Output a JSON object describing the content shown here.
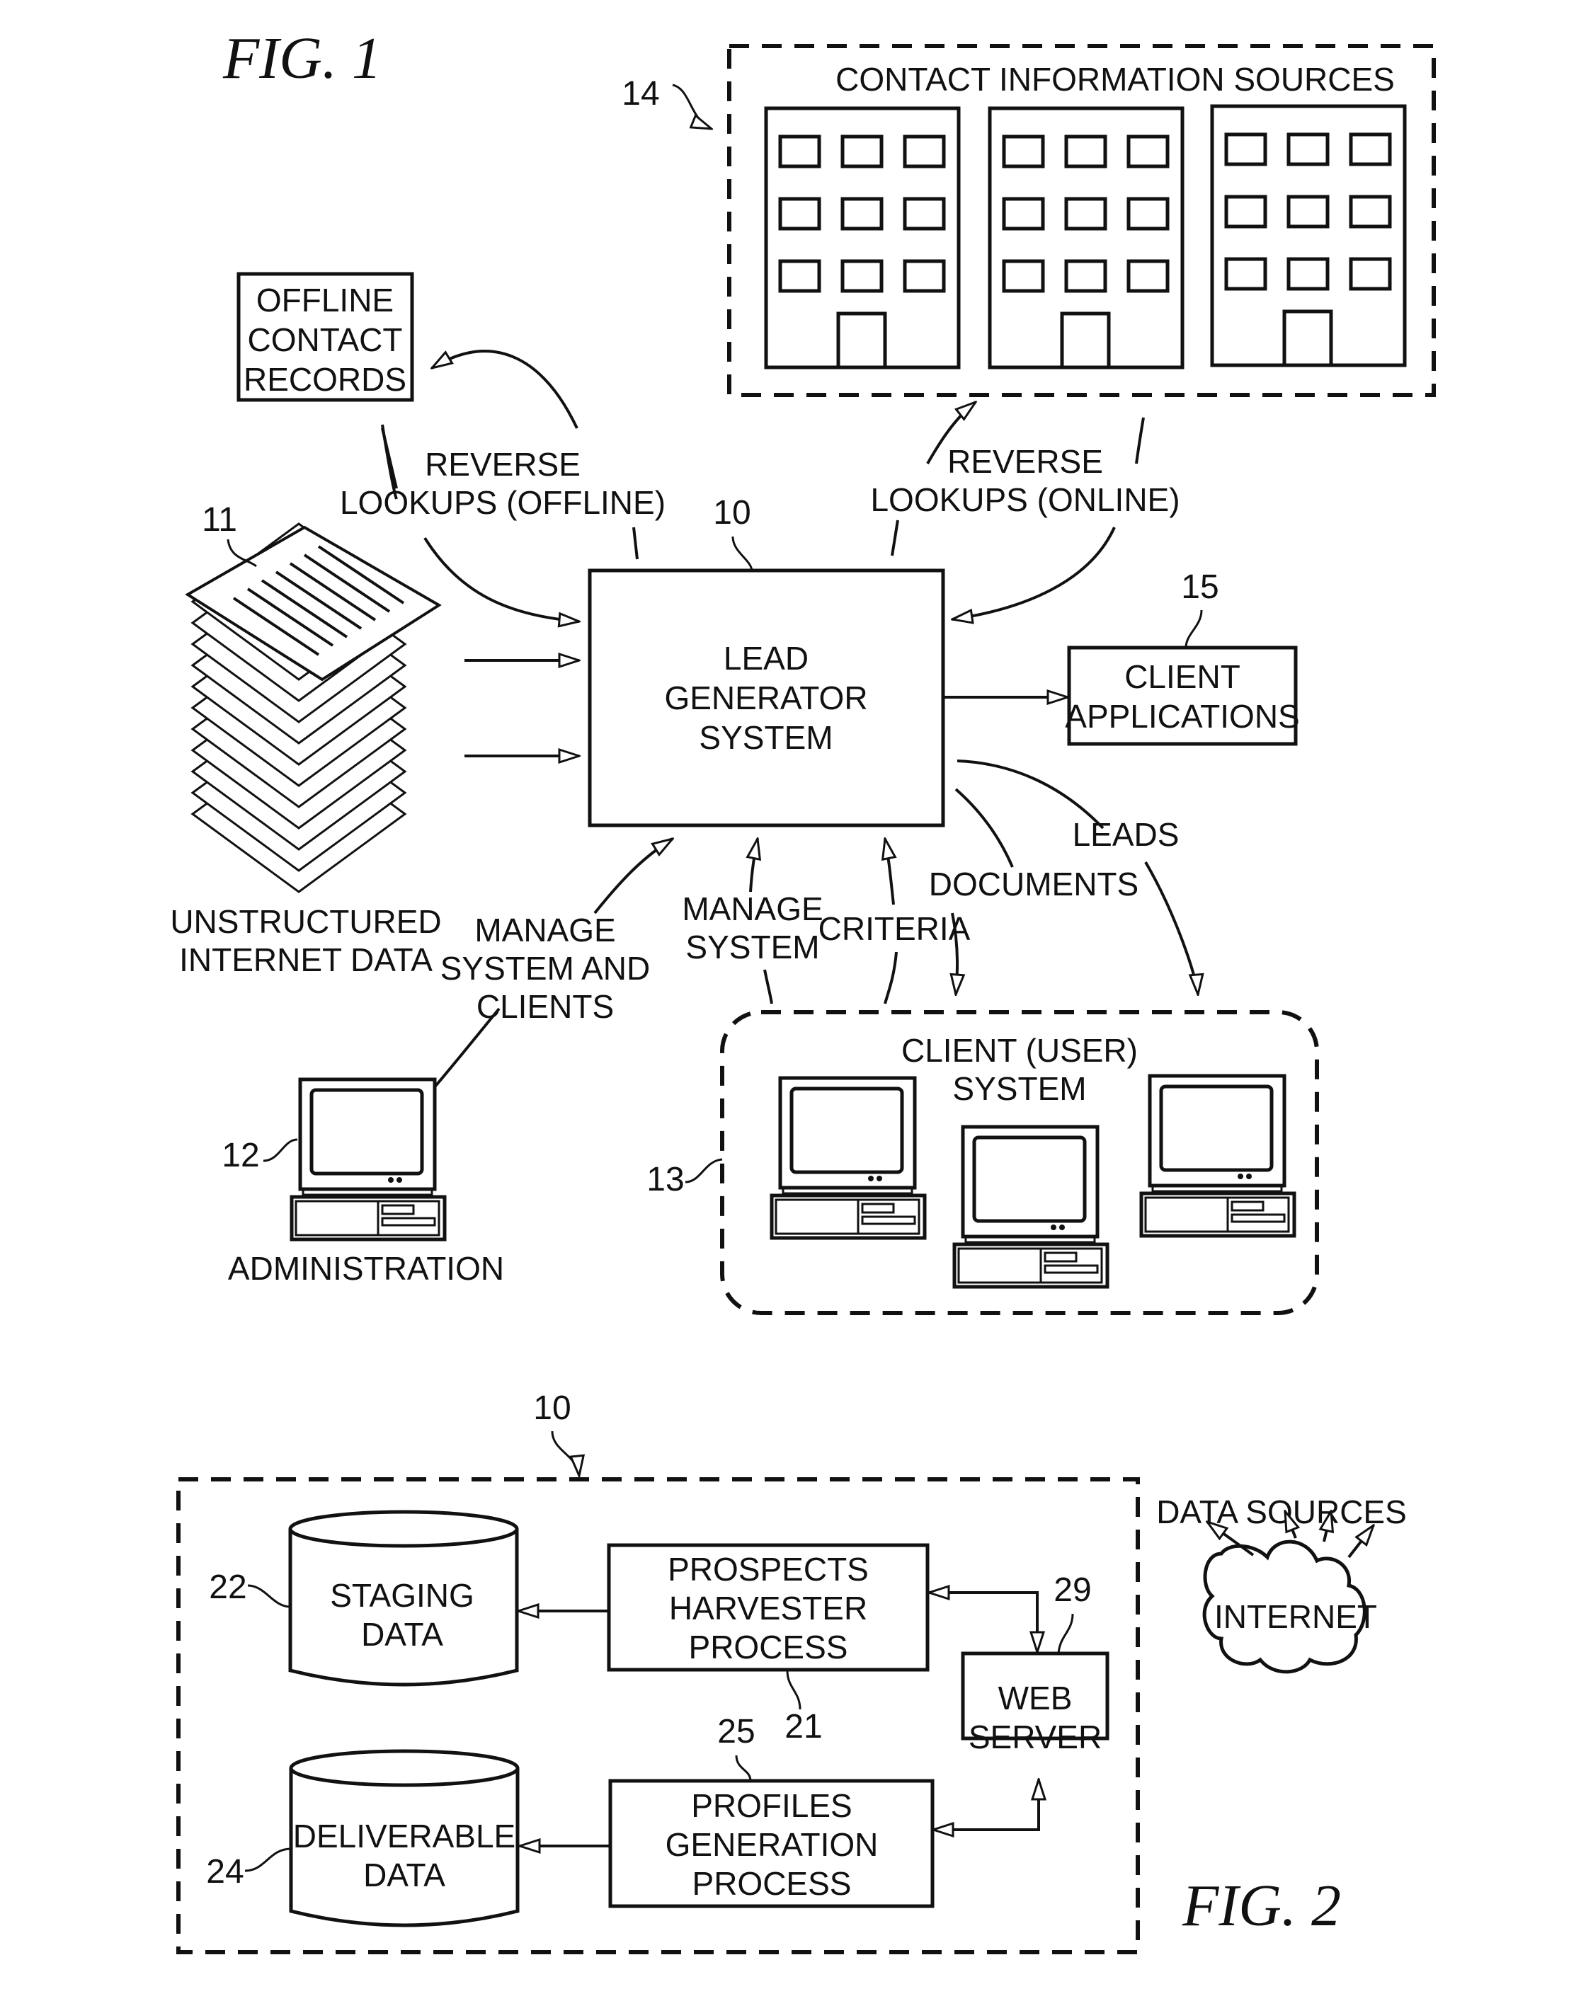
{
  "fig1": {
    "title": "FIG. 1",
    "contact_sources": {
      "ref": "14",
      "label": "CONTACT INFORMATION SOURCES"
    },
    "offline_records": {
      "lines": [
        "OFFLINE",
        "CONTACT",
        "RECORDS"
      ]
    },
    "reverse_offline": {
      "lines": [
        "REVERSE",
        "LOOKUPS (OFFLINE)"
      ]
    },
    "reverse_online": {
      "lines": [
        "REVERSE",
        "LOOKUPS (ONLINE)"
      ]
    },
    "unstructured": {
      "ref": "11",
      "lines": [
        "UNSTRUCTURED",
        "INTERNET DATA"
      ]
    },
    "lead_generator": {
      "ref": "10",
      "lines": [
        "LEAD",
        "GENERATOR",
        "SYSTEM"
      ]
    },
    "client_apps": {
      "ref": "15",
      "lines": [
        "CLIENT",
        "APPLICATIONS"
      ]
    },
    "manage_system_clients": {
      "lines": [
        "MANAGE",
        "SYSTEM AND",
        "CLIENTS"
      ]
    },
    "manage_system": {
      "lines": [
        "MANAGE",
        "SYSTEM"
      ]
    },
    "criteria": "CRITERIA",
    "documents": "DOCUMENTS",
    "leads": "LEADS",
    "administration": {
      "ref": "12",
      "label": "ADMINISTRATION"
    },
    "client_system": {
      "ref": "13",
      "lines": [
        "CLIENT (USER)",
        "SYSTEM"
      ]
    }
  },
  "fig2": {
    "title": "FIG. 2",
    "system_ref": "10",
    "staging": {
      "ref": "22",
      "lines": [
        "STAGING",
        "DATA"
      ]
    },
    "prospects": {
      "ref": "21",
      "lines": [
        "PROSPECTS",
        "HARVESTER",
        "PROCESS"
      ]
    },
    "web_server": {
      "ref": "29",
      "lines": [
        "WEB",
        "SERVER"
      ]
    },
    "profiles": {
      "ref": "25",
      "lines": [
        "PROFILES",
        "GENERATION",
        "PROCESS"
      ]
    },
    "deliverable": {
      "ref": "24",
      "lines": [
        "DELIVERABLE",
        "DATA"
      ]
    },
    "data_sources": "DATA SOURCES",
    "internet": "INTERNET"
  }
}
